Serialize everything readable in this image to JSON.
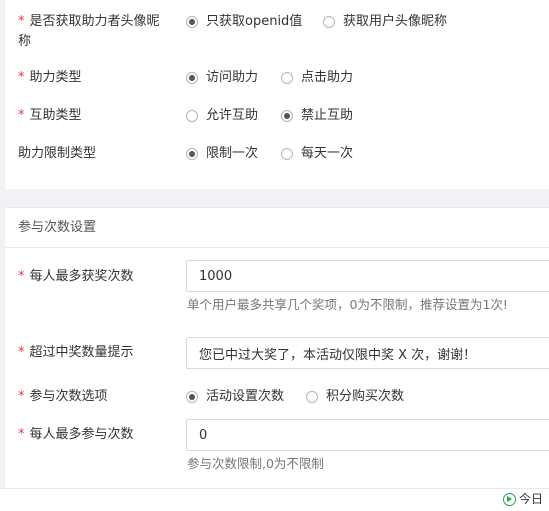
{
  "avatar_setting": {
    "required": "*",
    "label": "是否获取助力者头像昵称",
    "options": [
      {
        "label": "只获取openid值",
        "selected": true
      },
      {
        "label": "获取用户头像昵称",
        "selected": false
      }
    ]
  },
  "assist_type": {
    "required": "*",
    "label": "助力类型",
    "options": [
      {
        "label": "访问助力",
        "selected": true
      },
      {
        "label": "点击助力",
        "selected": false
      }
    ]
  },
  "mutual_type": {
    "required": "*",
    "label": "互助类型",
    "options": [
      {
        "label": "允许互助",
        "selected": false
      },
      {
        "label": "禁止互助",
        "selected": true
      }
    ]
  },
  "limit_type": {
    "label": "助力限制类型",
    "options": [
      {
        "label": "限制一次",
        "selected": true
      },
      {
        "label": "每天一次",
        "selected": false
      }
    ]
  },
  "participation": {
    "section_title": "参与次数设置",
    "max_prizes": {
      "required": "*",
      "label": "每人最多获奖次数",
      "value": "1000",
      "hint": "单个用户最多共享几个奖项，0为不限制，推荐设置为1次!"
    },
    "over_limit_tip": {
      "required": "*",
      "label": "超过中奖数量提示",
      "value": "您已中过大奖了，本活动仅限中奖 X 次，谢谢！"
    },
    "count_option": {
      "required": "*",
      "label": "参与次数选项",
      "options": [
        {
          "label": "活动设置次数",
          "selected": true
        },
        {
          "label": "积分购买次数",
          "selected": false
        }
      ]
    },
    "max_participation": {
      "required": "*",
      "label": "每人最多参与次数",
      "value": "0",
      "hint": "参与次数限制,0为不限制"
    }
  },
  "bottom_bar": {
    "today_label": "今日"
  }
}
